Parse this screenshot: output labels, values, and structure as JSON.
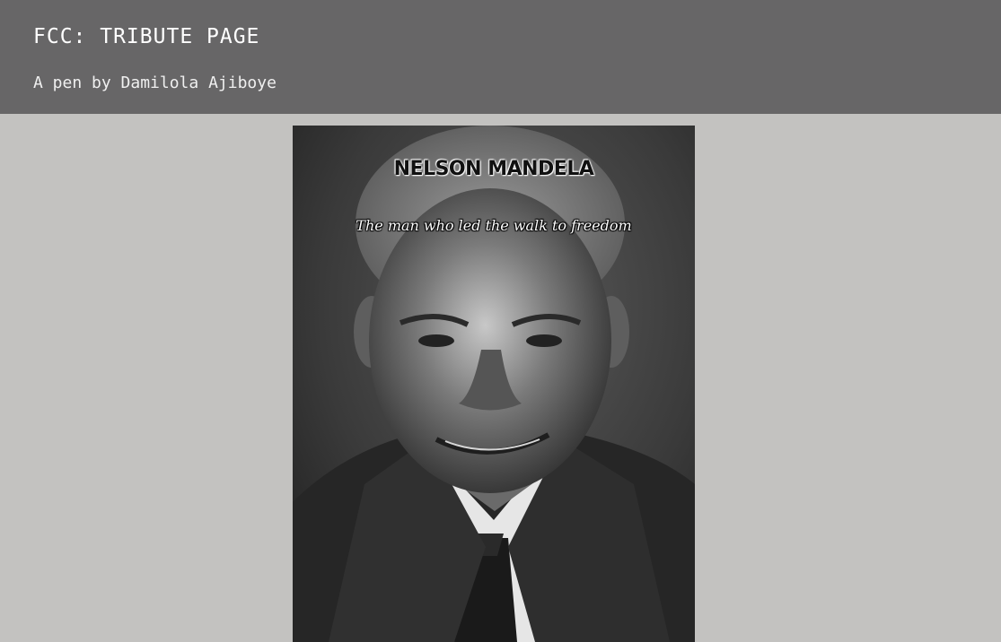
{
  "header": {
    "title": "FCC: TRIBUTE PAGE",
    "byline": "A pen by Damilola Ajiboye"
  },
  "portrait": {
    "icon": "portrait-photo",
    "heading": "NELSON MANDELA",
    "tagline": "The man who led the walk to freedom"
  },
  "colors": {
    "page_background": "#c3c2c0",
    "header_background": "#676667",
    "header_text": "#ffffff"
  }
}
